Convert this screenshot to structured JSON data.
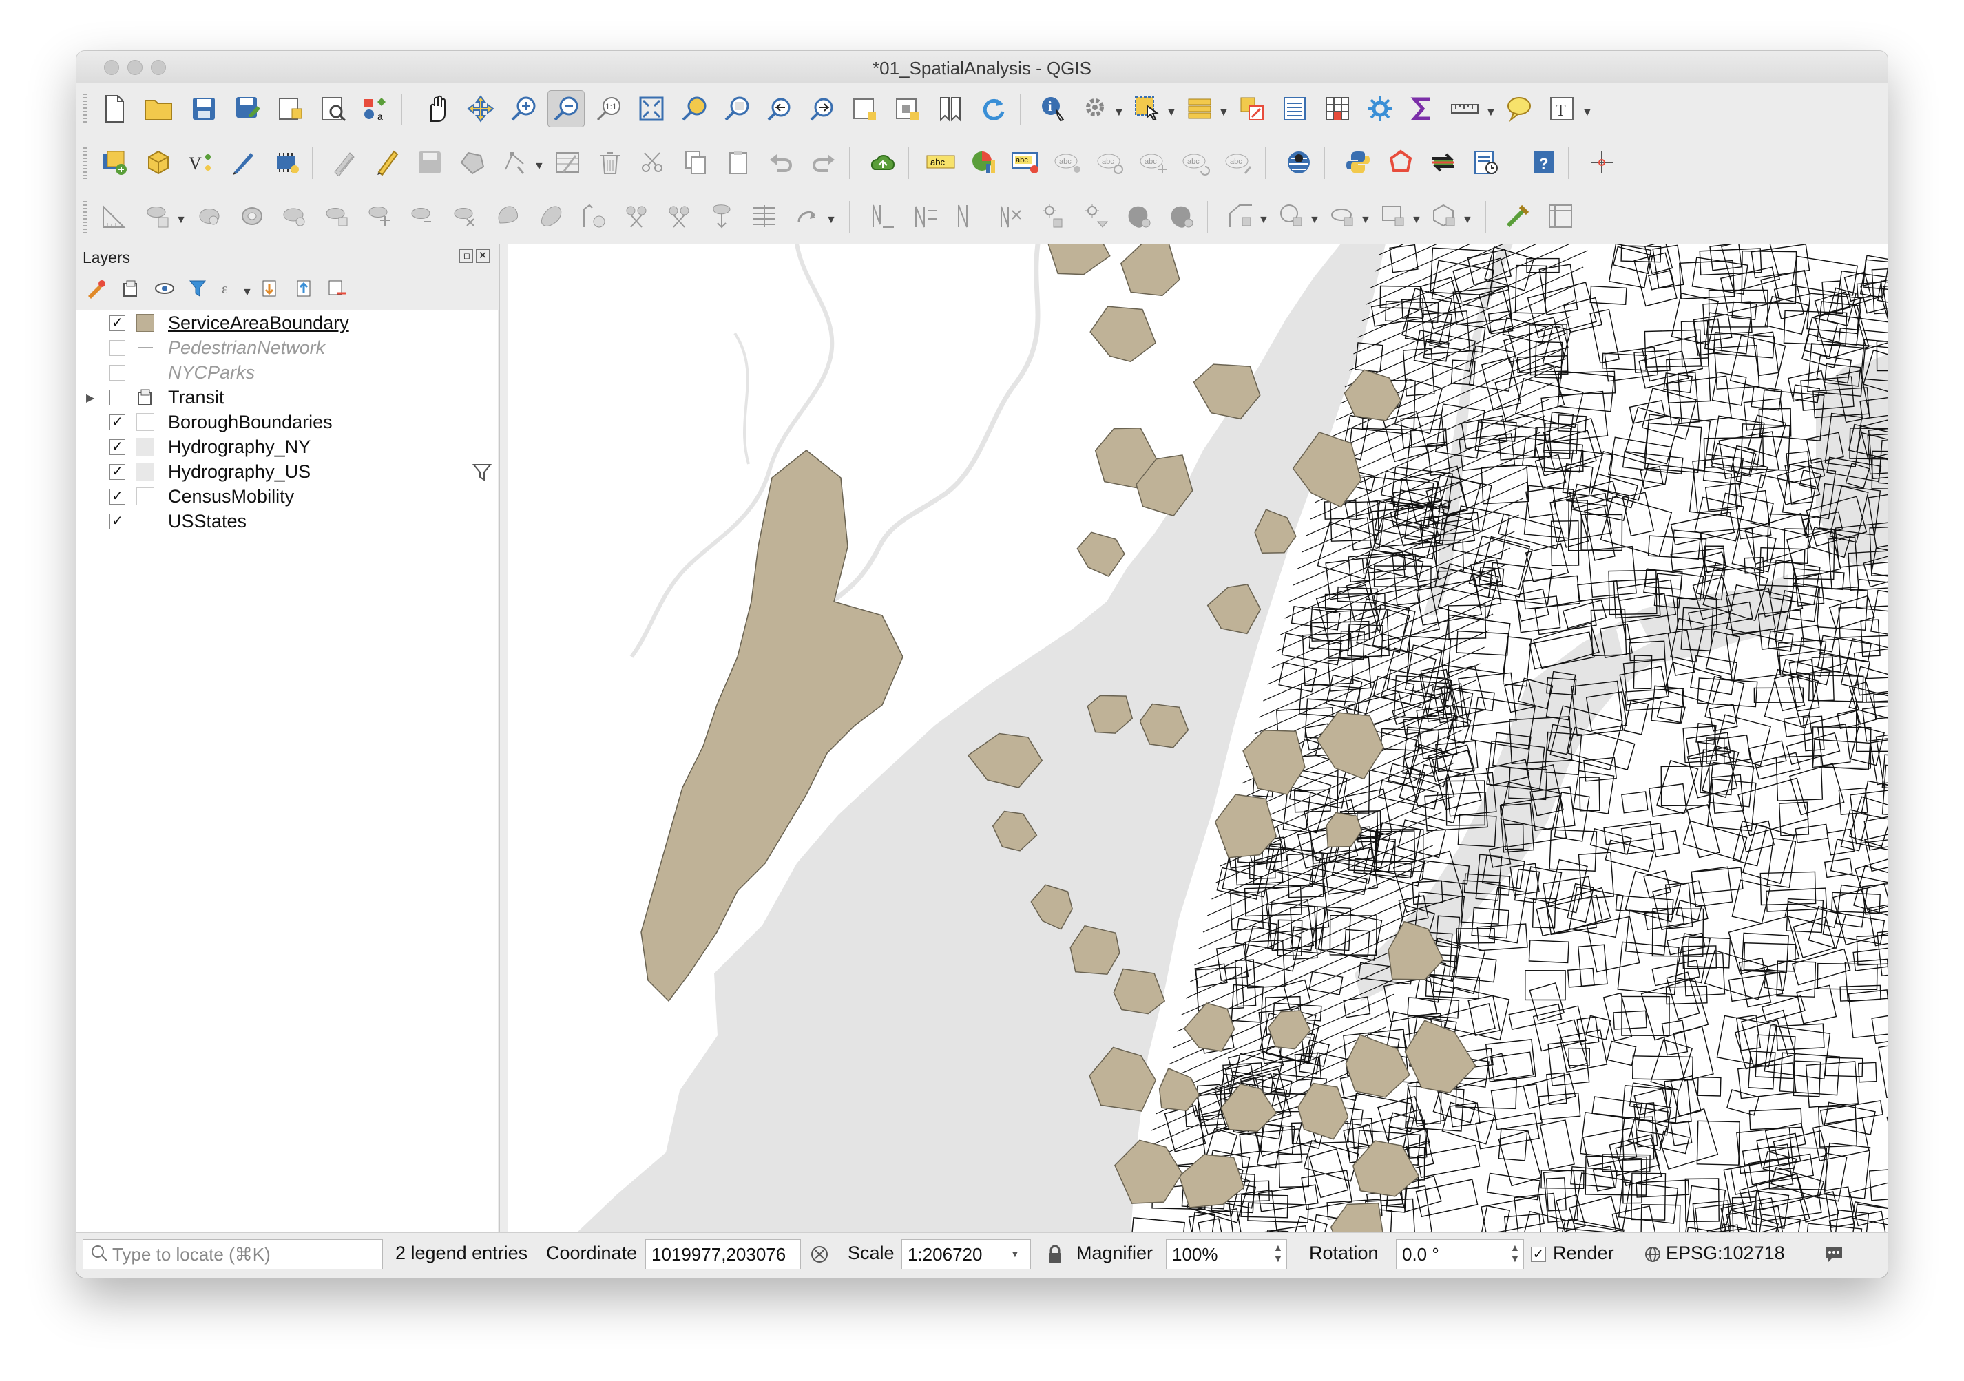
{
  "window": {
    "title": "*01_SpatialAnalysis - QGIS"
  },
  "toolbars": {
    "row1": [
      "new-project",
      "open-project",
      "save-project",
      "save-as",
      "new-print-layout",
      "layout-manager",
      "style-manager",
      "pan",
      "pan-to-selection",
      "zoom-in",
      "zoom-out",
      "zoom-native",
      "zoom-full",
      "zoom-to-selection",
      "zoom-to-layer",
      "zoom-last",
      "zoom-next",
      "new-map-view",
      "new-3d-map-view",
      "new-bookmark",
      "refresh",
      "identify",
      "run-action",
      "select-features",
      "open-attribute-table",
      "deselect",
      "field-calculator",
      "statistical-summary",
      "processing-toolbox",
      "sum",
      "measure",
      "map-tips",
      "text-annotation"
    ],
    "row2": [
      "data-source-manager",
      "new-geopackage-layer",
      "digitizing",
      "add-vector-layer",
      "temporary-scratch-layer",
      "toggle-editing",
      "current-edits",
      "save-edits",
      "add-feature",
      "vertex-tool",
      "modify-attributes",
      "delete-selected",
      "cut-features",
      "copy-features",
      "paste-features",
      "undo",
      "redo",
      "georeferencer",
      "label-toolbar",
      "diagram",
      "layer-labeling",
      "pin-labels",
      "show-labels",
      "move-label",
      "rotate-label",
      "change-label",
      "geocoder",
      "python-console",
      "polygon-tool",
      "sync",
      "temporal-controller",
      "help",
      "crosshair"
    ],
    "row3": [
      "advanced-digitizing",
      "add-ring",
      "add-part",
      "fill-ring",
      "delete-ring",
      "delete-part",
      "reshape",
      "offset-curve",
      "split-features",
      "split-parts",
      "merge-selected",
      "merge-attributes",
      "rotate-point-symbols",
      "offset-point-symbols",
      "simplify",
      "rotate-feature",
      "scale-feature",
      "trim-extend",
      "reverse-line",
      "shape-digitizing",
      "regular-polygon",
      "ellipse",
      "rectangle",
      "polygon-shapes",
      "tracing",
      "snapping"
    ]
  },
  "layers_panel": {
    "title": "Layers",
    "toolbar": [
      "style-icon",
      "add-group-icon",
      "visibility-icon",
      "filter-icon",
      "expression-icon",
      "expand-all-icon",
      "collapse-all-icon",
      "remove-layer-icon"
    ],
    "layers": [
      {
        "name": "ServiceAreaBoundary",
        "checked": true,
        "enabled": true,
        "symbol": "fill",
        "color": "#bfb297",
        "selected": true
      },
      {
        "name": "PedestrianNetwork",
        "checked": false,
        "enabled": false,
        "symbol": "line",
        "color": "#aaaaaa"
      },
      {
        "name": "NYCParks",
        "checked": false,
        "enabled": false,
        "symbol": "none"
      },
      {
        "name": "Transit",
        "checked": false,
        "enabled": true,
        "symbol": "group",
        "expandable": true
      },
      {
        "name": "BoroughBoundaries",
        "checked": true,
        "enabled": true,
        "symbol": "outline"
      },
      {
        "name": "Hydrography_NY",
        "checked": true,
        "enabled": true,
        "symbol": "fill",
        "color": "#e8e8e8"
      },
      {
        "name": "Hydrography_US",
        "checked": true,
        "enabled": true,
        "symbol": "fill",
        "color": "#e8e8e8",
        "filter": true
      },
      {
        "name": "CensusMobility",
        "checked": true,
        "enabled": true,
        "symbol": "outline"
      },
      {
        "name": "USStates",
        "checked": true,
        "enabled": true,
        "symbol": "none"
      }
    ],
    "check": "✓"
  },
  "map": {
    "water_color": "#e4e4e4",
    "service_color": "#bfb297",
    "line_color": "#111111"
  },
  "status": {
    "locate_placeholder": "Type to locate (⌘K)",
    "legend_entries": "2 legend entries",
    "coordinate_label": "Coordinate",
    "coordinate_value": "1019977,203076",
    "scale_label": "Scale",
    "scale_value": "1:206720",
    "magnifier_label": "Magnifier",
    "magnifier_value": "100%",
    "rotation_label": "Rotation",
    "rotation_value": "0.0 °",
    "render_label": "Render",
    "render_checked": "✓",
    "crs": "EPSG:102718"
  }
}
